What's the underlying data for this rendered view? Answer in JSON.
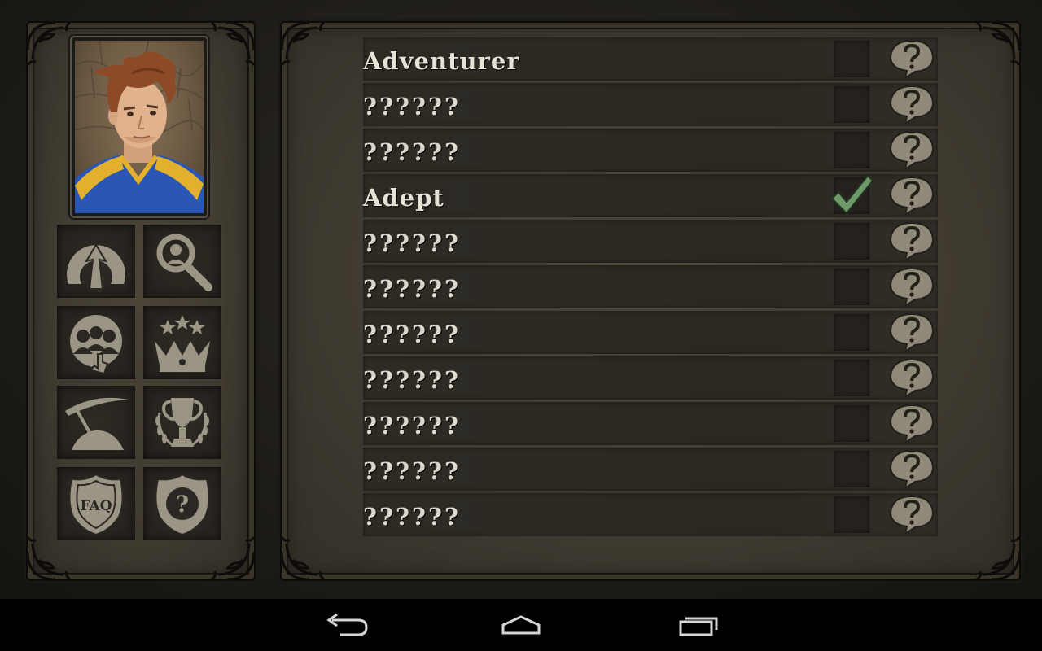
{
  "ranks": [
    {
      "label": "Adventurer",
      "unlocked": true,
      "completed": false
    },
    {
      "label": "??????",
      "unlocked": false,
      "completed": false
    },
    {
      "label": "??????",
      "unlocked": false,
      "completed": false
    },
    {
      "label": "Adept",
      "unlocked": true,
      "completed": true
    },
    {
      "label": "??????",
      "unlocked": false,
      "completed": false
    },
    {
      "label": "??????",
      "unlocked": false,
      "completed": false
    },
    {
      "label": "??????",
      "unlocked": false,
      "completed": false
    },
    {
      "label": "??????",
      "unlocked": false,
      "completed": false
    },
    {
      "label": "??????",
      "unlocked": false,
      "completed": false
    },
    {
      "label": "??????",
      "unlocked": false,
      "completed": false
    },
    {
      "label": "??????",
      "unlocked": false,
      "completed": false
    }
  ],
  "menu": {
    "faq_label": "FAQ",
    "help_symbol": "?"
  },
  "icons": {
    "hint": "speech-bubble-question-icon",
    "check": "green-checkmark-icon"
  },
  "colors": {
    "check_green": "#6e9a6a",
    "text": "#e6e2d6",
    "icon_fill": "#9b9586"
  }
}
